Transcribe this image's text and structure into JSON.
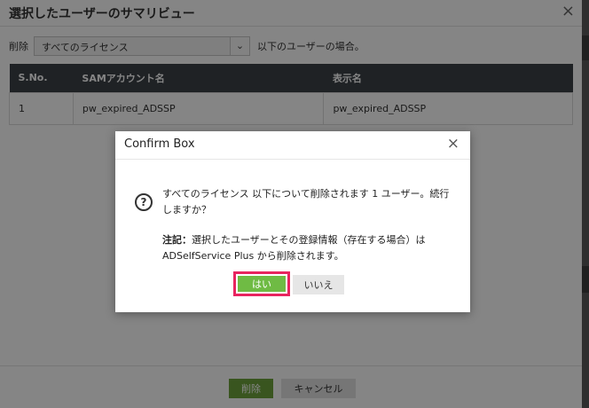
{
  "panel": {
    "title": "選択したユーザーのサマリビュー",
    "close_glyph": "×",
    "filter": {
      "label": "削除",
      "selected": "すべてのライセンス",
      "arrow_glyph": "⌄",
      "suffix": "以下のユーザーの場合。"
    },
    "table": {
      "headers": [
        "S.No.",
        "SAMアカウント名",
        "表示名"
      ],
      "rows": [
        [
          "1",
          "pw_expired_ADSSP",
          "pw_expired_ADSSP"
        ]
      ]
    },
    "footer": {
      "delete_label": "削除",
      "cancel_label": "キャンセル"
    }
  },
  "modal": {
    "title": "Confirm Box",
    "close_glyph": "×",
    "icon_glyph": "?",
    "message": "すべてのライセンス 以下について削除されます 1 ユーザー。続行しますか？",
    "note_label": "注記：",
    "note_text": "選択したユーザーとその登録情報（存在する場合）は ADSelfService Plus から削除されます。",
    "yes_label": "はい",
    "no_label": "いいえ"
  },
  "colors": {
    "table_header_bg": "#3c4148",
    "primary_green": "#6fbb44",
    "highlight_border": "#e8245f"
  }
}
